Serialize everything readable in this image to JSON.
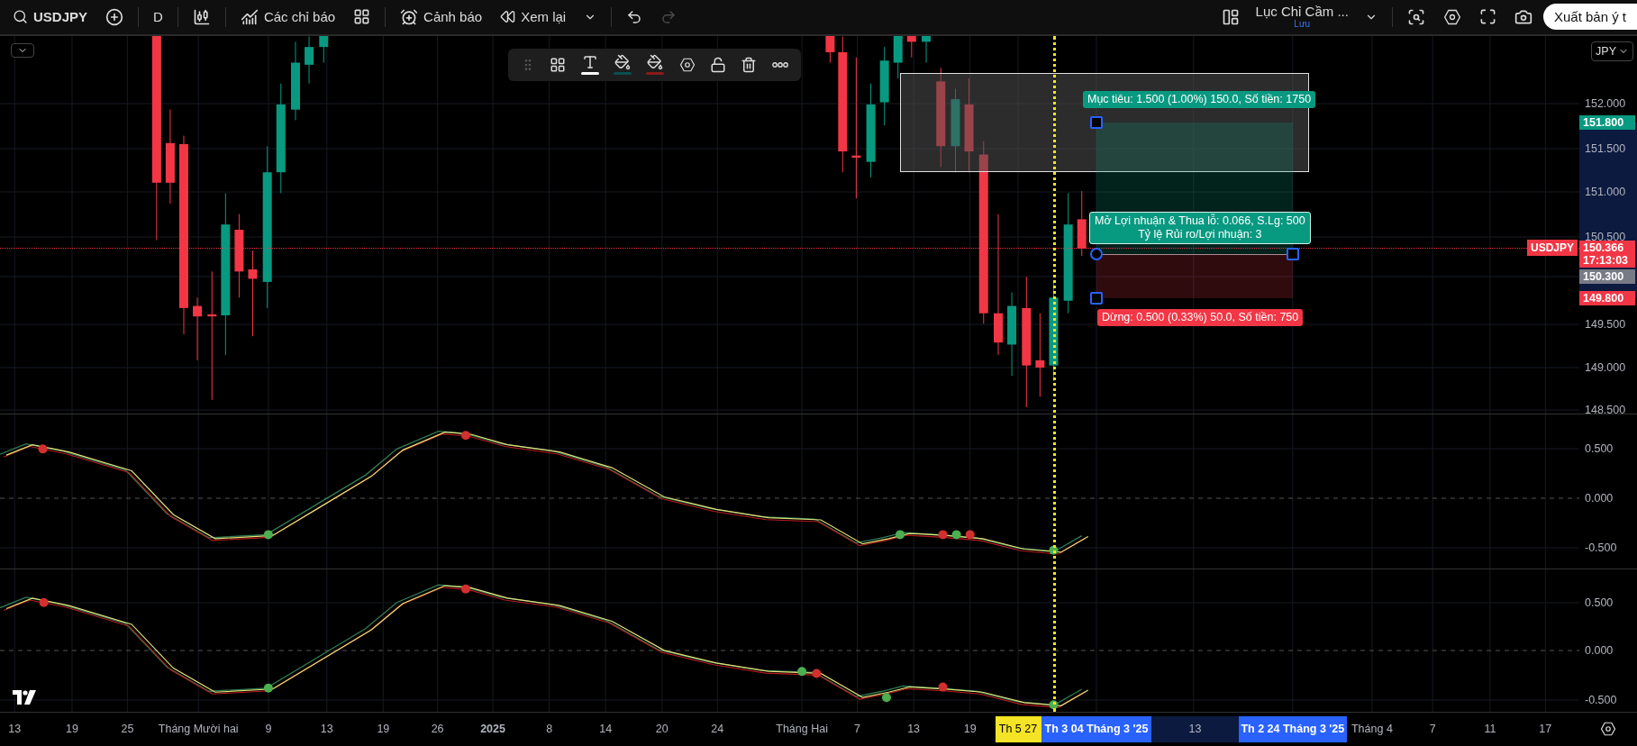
{
  "toolbar": {
    "symbol": "USDJPY",
    "interval": "D",
    "indicators": "Các chỉ báo",
    "alerts": "Cảnh báo",
    "replay": "Xem lại",
    "redo_disabled": true,
    "layout_name": "Lục Chỉ Cầm ...",
    "layout_status": "Lưu",
    "publish": "Xuất bản ý t"
  },
  "currency": "JPY",
  "price_axis": [
    {
      "label": "152.000",
      "kind": "tick"
    },
    {
      "label": "151.800",
      "kind": "tag",
      "color": "#089981"
    },
    {
      "label": "151.500",
      "kind": "tick"
    },
    {
      "label": "151.000",
      "kind": "tick"
    },
    {
      "label": "150.500",
      "kind": "tick"
    },
    {
      "label": "150.366",
      "kind": "tag",
      "color": "#f23645",
      "countdown": "17:13:03"
    },
    {
      "label": "150.300",
      "kind": "tag",
      "color": "#787b86"
    },
    {
      "label": "149.800",
      "kind": "tag",
      "color": "#f23645"
    },
    {
      "label": "149.500",
      "kind": "tick"
    },
    {
      "label": "149.000",
      "kind": "tick"
    },
    {
      "label": "148.500",
      "kind": "tick"
    }
  ],
  "symbol_tag": "USDJPY",
  "position": {
    "target_label": "Mục tiêu: 1.500 (1.00%) 150.0, Số tiền: 1750",
    "info_lines": [
      "Mở Lợi nhuận & Thua lỗ: 0.066, S.Lg: 500",
      "Tỷ lệ Rủi ro/Lợi nhuận: 3"
    ],
    "stop_label": "Dừng: 0.500 (0.33%) 50.0, Số tiền: 750"
  },
  "oscillators": [
    {
      "ticks": [
        "0.500",
        "0.000",
        "-0.500"
      ]
    },
    {
      "ticks": [
        "0.500",
        "0.000",
        "-0.500"
      ]
    }
  ],
  "time_axis": [
    {
      "label": "13",
      "kind": "tick"
    },
    {
      "label": "19",
      "kind": "tick"
    },
    {
      "label": "25",
      "kind": "tick"
    },
    {
      "label": "Tháng Mười hai",
      "kind": "tick"
    },
    {
      "label": "9",
      "kind": "tick"
    },
    {
      "label": "13",
      "kind": "tick"
    },
    {
      "label": "19",
      "kind": "tick"
    },
    {
      "label": "26",
      "kind": "tick"
    },
    {
      "label": "2025",
      "kind": "year"
    },
    {
      "label": "8",
      "kind": "tick"
    },
    {
      "label": "14",
      "kind": "tick"
    },
    {
      "label": "20",
      "kind": "tick"
    },
    {
      "label": "24",
      "kind": "tick"
    },
    {
      "label": "Tháng Hai",
      "kind": "tick"
    },
    {
      "label": "7",
      "kind": "tick"
    },
    {
      "label": "13",
      "kind": "tick"
    },
    {
      "label": "19",
      "kind": "tick"
    },
    {
      "label": "Th 5 27",
      "kind": "cursor"
    },
    {
      "label": "Th 3 04 Tháng 3 '25",
      "kind": "range"
    },
    {
      "label": "13",
      "kind": "in_range"
    },
    {
      "label": "Th 2 24 Tháng 3 '25",
      "kind": "range"
    },
    {
      "label": "Tháng 4",
      "kind": "tick"
    },
    {
      "label": "7",
      "kind": "tick"
    },
    {
      "label": "11",
      "kind": "tick"
    },
    {
      "label": "17",
      "kind": "tick"
    }
  ]
}
